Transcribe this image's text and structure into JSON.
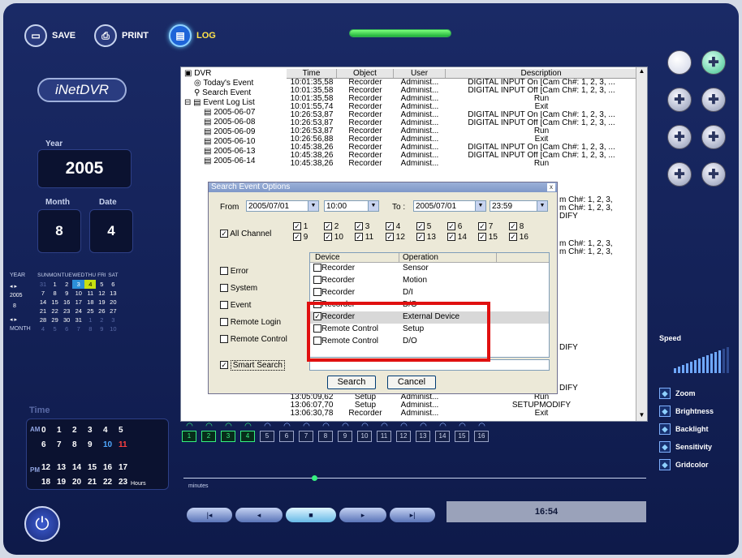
{
  "toolbar": {
    "save": "SAVE",
    "print": "PRINT",
    "log": "LOG"
  },
  "logo": "iNetDVR",
  "date": {
    "year_label": "Year",
    "year": "2005",
    "month_label": "Month",
    "month": "8",
    "date_label": "Date",
    "date": "4"
  },
  "calendar": {
    "year_label": "YEAR",
    "month_label": "MONTH",
    "year": "2005",
    "month": "8",
    "days": [
      "SUN",
      "MON",
      "TUE",
      "WED",
      "THU",
      "FRI",
      "SAT"
    ],
    "weeks": [
      [
        "31",
        "1",
        "2",
        "3",
        "4",
        "5",
        "6"
      ],
      [
        "7",
        "8",
        "9",
        "10",
        "11",
        "12",
        "13"
      ],
      [
        "14",
        "15",
        "16",
        "17",
        "18",
        "19",
        "20"
      ],
      [
        "21",
        "22",
        "23",
        "24",
        "25",
        "26",
        "27"
      ],
      [
        "28",
        "29",
        "30",
        "31",
        "1",
        "2",
        "3"
      ],
      [
        "4",
        "5",
        "6",
        "7",
        "8",
        "9",
        "10"
      ]
    ]
  },
  "time": {
    "label": "Time",
    "am": "AM",
    "pm": "PM",
    "hours_label": "Hours",
    "minutes_label": "minutes",
    "am_row1": [
      "0",
      "1",
      "2",
      "3",
      "4",
      "5"
    ],
    "am_row2": [
      "6",
      "7",
      "8",
      "9",
      "10",
      "11"
    ],
    "pm_row1": [
      "12",
      "13",
      "14",
      "15",
      "16",
      "17"
    ],
    "pm_row2": [
      "18",
      "19",
      "20",
      "21",
      "22",
      "23"
    ]
  },
  "tree": {
    "root": "DVR",
    "today": "Today's Event",
    "search": "Search Event",
    "log_list": "Event Log List",
    "dates": [
      "2005-06-07",
      "2005-06-08",
      "2005-06-09",
      "2005-06-10",
      "2005-06-13",
      "2005-06-14"
    ]
  },
  "log_grid": {
    "headers": [
      "Time",
      "Object",
      "User",
      "Description"
    ],
    "rows": [
      [
        "10:01:35,58",
        "Recorder",
        "Administ...",
        "DIGITAL INPUT On [Cam Ch#: 1, 2, 3, ..."
      ],
      [
        "10:01:35,58",
        "Recorder",
        "Administ...",
        "DIGITAL INPUT Off [Cam Ch#: 1, 2, 3, ..."
      ],
      [
        "10:01:35,58",
        "Recorder",
        "Administ...",
        "Run"
      ],
      [
        "10:01:55,74",
        "Recorder",
        "Administ...",
        "Exit"
      ],
      [
        "10:26:53,87",
        "Recorder",
        "Administ...",
        "DIGITAL INPUT On [Cam Ch#: 1, 2, 3, ..."
      ],
      [
        "10:26:53,87",
        "Recorder",
        "Administ...",
        "DIGITAL INPUT Off [Cam Ch#: 1, 2, 3, ..."
      ],
      [
        "10:26:53,87",
        "Recorder",
        "Administ...",
        "Run"
      ],
      [
        "10:26:56,88",
        "Recorder",
        "Administ...",
        "Exit"
      ],
      [
        "10:45:38,26",
        "Recorder",
        "Administ...",
        "DIGITAL INPUT On [Cam Ch#: 1, 2, 3, ..."
      ],
      [
        "10:45:38,26",
        "Recorder",
        "Administ...",
        "DIGITAL INPUT Off [Cam Ch#: 1, 2, 3, ..."
      ],
      [
        "10:45:38,26",
        "Recorder",
        "Administ...",
        "Run"
      ]
    ],
    "right_fragments": [
      "m Ch#: 1, 2, 3,",
      "m Ch#: 1, 2, 3,",
      "DIFY",
      "m Ch#: 1, 2, 3,",
      "m Ch#: 1, 2, 3,",
      "DIFY",
      "DIFY"
    ],
    "bottom_rows": [
      [
        "13:05:09,62",
        "Setup",
        "Administ...",
        "Run"
      ],
      [
        "13:06:07,70",
        "Setup",
        "Administ...",
        "SETUPMODIFY"
      ],
      [
        "13:06:30,78",
        "Recorder",
        "Administ...",
        "Exit"
      ]
    ]
  },
  "dialog": {
    "title": "Search Event Options",
    "close": "x",
    "from_label": "From",
    "from_date": "2005/07/01",
    "from_time": "10:00",
    "to_label": "To :",
    "to_date": "2005/07/01",
    "to_time": "23:59",
    "all_channel": "All Channel",
    "channels": [
      "1",
      "2",
      "3",
      "4",
      "5",
      "6",
      "7",
      "8",
      "9",
      "10",
      "11",
      "12",
      "13",
      "14",
      "15",
      "16"
    ],
    "types": [
      "Error",
      "System",
      "Event",
      "Remote Login",
      "Remote Control"
    ],
    "smart_search": "Smart Search",
    "table_headers": [
      "Device",
      "Operation"
    ],
    "table_rows": [
      {
        "device": "Recorder",
        "op": "Sensor",
        "checked": false
      },
      {
        "device": "Recorder",
        "op": "Motion",
        "checked": false
      },
      {
        "device": "Recorder",
        "op": "D/I",
        "checked": false
      },
      {
        "device": "Recorder",
        "op": "D/O",
        "checked": false
      },
      {
        "device": "Recorder",
        "op": "External Device",
        "checked": true
      },
      {
        "device": "Remote Control",
        "op": "Setup",
        "checked": false
      },
      {
        "device": "Remote Control",
        "op": "D/O",
        "checked": false
      }
    ],
    "search_btn": "Search",
    "cancel_btn": "Cancel"
  },
  "right_panel": {
    "speed": "Speed",
    "options": [
      {
        "icon": "zoom-icon",
        "label": "Zoom"
      },
      {
        "icon": "brightness-icon",
        "label": "Brightness"
      },
      {
        "icon": "backlight-icon",
        "label": "Backlight"
      },
      {
        "icon": "sensitivity-icon",
        "label": "Sensitivity"
      },
      {
        "icon": "gridcolor-icon",
        "label": "Gridcolor"
      }
    ]
  },
  "cameras": {
    "labels": [
      "1",
      "2",
      "3",
      "4",
      "5",
      "6",
      "7",
      "8",
      "9",
      "10",
      "11",
      "12",
      "13",
      "14",
      "15",
      "16"
    ],
    "active": [
      1,
      2,
      3,
      4
    ]
  },
  "clock": "16:54",
  "colors": {
    "accent_green": "#36f080",
    "highlight_red": "#e01010",
    "bg": "#0e1a4a"
  }
}
